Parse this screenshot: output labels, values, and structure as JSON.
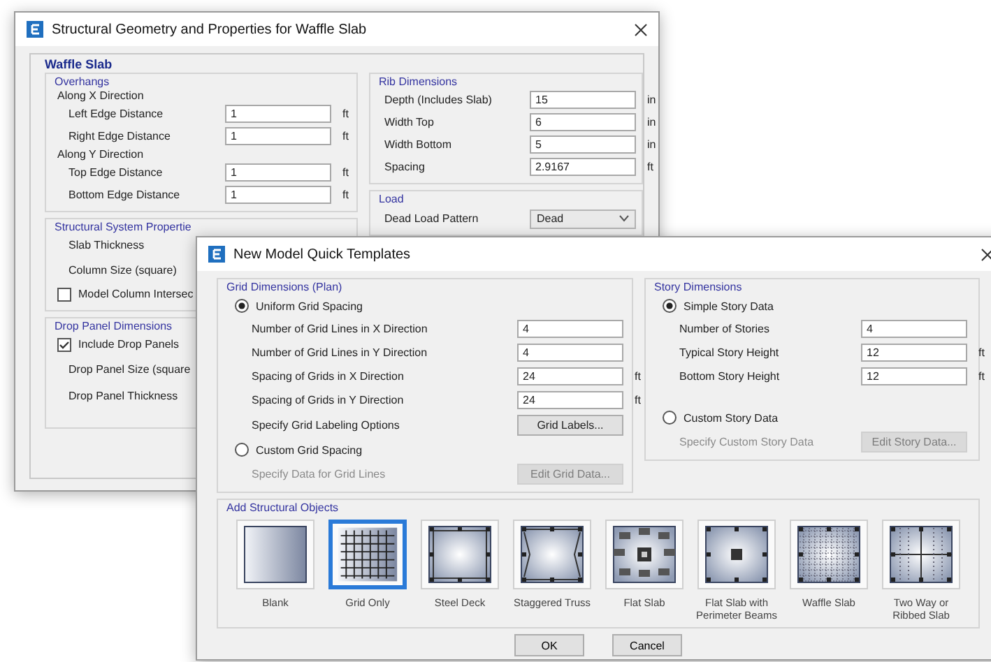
{
  "back_window": {
    "title": "Structural Geometry and Properties for Waffle Slab",
    "section_title": "Waffle Slab",
    "overhangs": {
      "title": "Overhangs",
      "groups": [
        {
          "title": "Along X Direction",
          "rows": [
            {
              "label": "Left Edge Distance",
              "value": "1",
              "unit": "ft"
            },
            {
              "label": "Right Edge Distance",
              "value": "1",
              "unit": "ft"
            }
          ]
        },
        {
          "title": "Along Y Direction",
          "rows": [
            {
              "label": "Top Edge Distance",
              "value": "1",
              "unit": "ft"
            },
            {
              "label": "Bottom Edge Distance",
              "value": "1",
              "unit": "ft"
            }
          ]
        }
      ]
    },
    "structural_system": {
      "title": "Structural System Propertie",
      "items": [
        {
          "kind": "label",
          "label": "Slab Thickness"
        },
        {
          "kind": "label",
          "label": "Column Size (square)"
        },
        {
          "kind": "checkbox",
          "label": "Model Column Intersec",
          "checked": false
        }
      ]
    },
    "drop_panel": {
      "title": "Drop Panel Dimensions",
      "items": [
        {
          "kind": "checkbox",
          "label": "Include Drop Panels",
          "checked": true
        },
        {
          "kind": "label",
          "label": "Drop Panel Size (square"
        },
        {
          "kind": "label",
          "label": "Drop Panel Thickness"
        }
      ]
    },
    "rib_dimensions": {
      "title": "Rib Dimensions",
      "rows": [
        {
          "label": "Depth (Includes Slab)",
          "value": "15",
          "unit": "in"
        },
        {
          "label": "Width Top",
          "value": "6",
          "unit": "in"
        },
        {
          "label": "Width Bottom",
          "value": "5",
          "unit": "in"
        },
        {
          "label": "Spacing",
          "value": "2.9167",
          "unit": "ft"
        }
      ]
    },
    "load": {
      "title": "Load",
      "rows": [
        {
          "label": "Dead Load Pattern",
          "value": "Dead"
        }
      ]
    }
  },
  "front_window": {
    "title": "New Model Quick Templates",
    "grid_dimensions": {
      "title": "Grid Dimensions (Plan)",
      "options": [
        {
          "label": "Uniform Grid Spacing",
          "selected": true,
          "rows": [
            {
              "kind": "field",
              "label": "Number of Grid Lines in X Direction",
              "value": "4"
            },
            {
              "kind": "field",
              "label": "Number of Grid Lines in Y Direction",
              "value": "4"
            },
            {
              "kind": "field",
              "label": "Spacing of Grids in X Direction",
              "value": "24",
              "unit": "ft"
            },
            {
              "kind": "field",
              "label": "Spacing of Grids in Y Direction",
              "value": "24",
              "unit": "ft"
            },
            {
              "kind": "button",
              "label": "Specify Grid Labeling Options",
              "button": "Grid Labels...",
              "disabled": false
            }
          ]
        },
        {
          "label": "Custom Grid Spacing",
          "selected": false,
          "rows": [
            {
              "kind": "button",
              "label": "Specify Data for Grid Lines",
              "button": "Edit Grid Data...",
              "disabled": true
            }
          ]
        }
      ]
    },
    "story_dimensions": {
      "title": "Story Dimensions",
      "options": [
        {
          "label": "Simple Story Data",
          "selected": true,
          "rows": [
            {
              "kind": "field",
              "label": "Number of Stories",
              "value": "4"
            },
            {
              "kind": "field",
              "label": "Typical Story Height",
              "value": "12",
              "unit": "ft"
            },
            {
              "kind": "field",
              "label": "Bottom Story Height",
              "value": "12",
              "unit": "ft"
            }
          ]
        },
        {
          "label": "Custom Story Data",
          "selected": false,
          "rows": [
            {
              "kind": "button",
              "label": "Specify Custom Story Data",
              "button": "Edit Story Data...",
              "disabled": true
            }
          ]
        }
      ]
    },
    "structural_objects": {
      "title": "Add Structural Objects",
      "templates": [
        {
          "kind": "blank",
          "label": "Blank",
          "selected": false
        },
        {
          "kind": "grid",
          "label": "Grid Only",
          "selected": true
        },
        {
          "kind": "deck",
          "label": "Steel Deck",
          "selected": false
        },
        {
          "kind": "truss",
          "label": "Staggered Truss",
          "selected": false
        },
        {
          "kind": "flat",
          "label": "Flat Slab",
          "selected": false
        },
        {
          "kind": "perimeter",
          "label": "Flat Slab with Perimeter Beams",
          "selected": false
        },
        {
          "kind": "waffle",
          "label": "Waffle Slab",
          "selected": false
        },
        {
          "kind": "ribbed",
          "label": "Two Way or Ribbed Slab",
          "selected": false
        }
      ]
    },
    "buttons": [
      "OK",
      "Cancel"
    ]
  }
}
